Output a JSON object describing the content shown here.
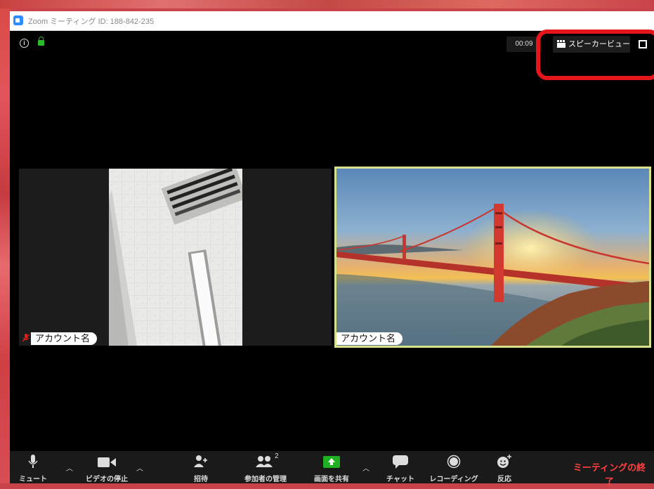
{
  "window": {
    "title": "Zoom ミーティング ID: 188-842-235"
  },
  "header": {
    "timer": "00:09",
    "view_button_label": "スピーカービュー"
  },
  "participants": [
    {
      "name": "アカウント名",
      "muted": true
    },
    {
      "name": "アカウント名",
      "muted": false,
      "active_speaker": true
    }
  ],
  "toolbar": {
    "mute_label": "ミュート",
    "video_label": "ビデオの停止",
    "invite_label": "招待",
    "participants_label": "参加者の管理",
    "participants_count": "2",
    "share_label": "画面を共有",
    "chat_label": "チャット",
    "record_label": "レコーディング",
    "reactions_label": "反応",
    "end_label": "ミーティングの終了"
  },
  "colors": {
    "zoom_blue": "#2d8cff",
    "lock_green": "#2aba2a",
    "share_green": "#21b021",
    "end_red": "#ff4040",
    "speaker_border": "#d7e08a",
    "annotation_red": "#e3161c"
  }
}
